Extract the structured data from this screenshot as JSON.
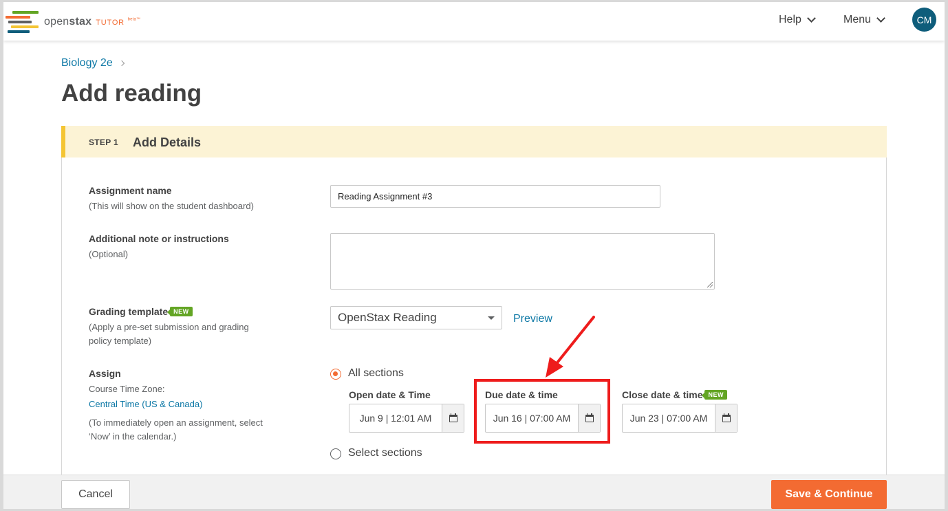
{
  "header": {
    "brand_open": "open",
    "brand_stax": "stax",
    "brand_tutor": "TUTOR",
    "brand_beta": "beta™",
    "help_label": "Help",
    "menu_label": "Menu",
    "avatar_initials": "CM",
    "logo_colors": [
      "#63a524",
      "#f36b32",
      "#5e6062",
      "#f4c534",
      "#0e5d7b"
    ]
  },
  "breadcrumb": {
    "course": "Biology 2e"
  },
  "page_title": "Add reading",
  "step": {
    "label": "STEP 1",
    "title": "Add Details"
  },
  "form": {
    "assignment_name": {
      "label": "Assignment name",
      "hint": "(This will show on the student dashboard)",
      "value": "Reading Assignment #3"
    },
    "note": {
      "label": "Additional note or instructions",
      "hint": "(Optional)",
      "value": ""
    },
    "grading": {
      "label": "Grading template",
      "badge": "NEW",
      "hint_line1": "(Apply a pre-set submission and grading",
      "hint_line2": "policy template)",
      "selected": "OpenStax Reading",
      "preview_label": "Preview"
    },
    "assign": {
      "label": "Assign",
      "timezone_label": "Course Time Zone:",
      "timezone_link": "Central Time (US & Canada)",
      "hint_line1": "(To immediately open an assignment, select",
      "hint_line2": "‘Now’ in the calendar.)",
      "all_sections_label": "All sections",
      "select_sections_label": "Select sections",
      "open": {
        "label": "Open date & Time",
        "value": "Jun 9 | 12:01 AM"
      },
      "due": {
        "label": "Due date & time",
        "value": "Jun 16 | 07:00 AM"
      },
      "close": {
        "label": "Close date & time",
        "badge": "NEW",
        "value": "Jun 23 | 07:00 AM"
      }
    }
  },
  "footer": {
    "cancel_label": "Cancel",
    "save_label": "Save & Continue"
  },
  "colors": {
    "accent": "#f36b32",
    "link": "#0b77a5",
    "annotation": "#ee1c1c",
    "new_badge": "#63a524"
  }
}
